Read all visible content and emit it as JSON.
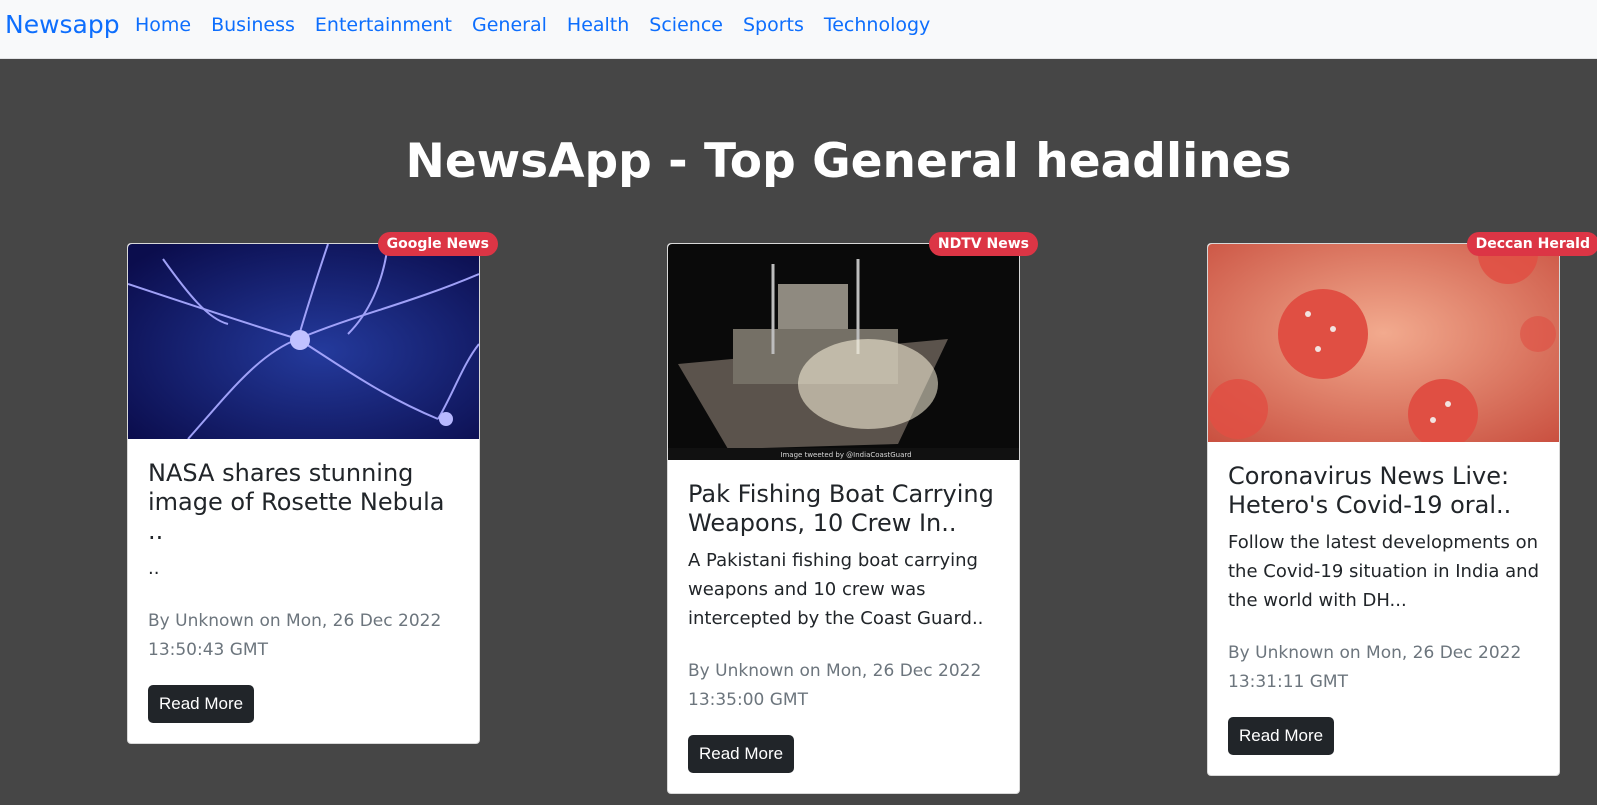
{
  "navbar": {
    "brand": "Newsapp",
    "links": [
      "Home",
      "Business",
      "Entertainment",
      "General",
      "Health",
      "Science",
      "Sports",
      "Technology"
    ]
  },
  "page": {
    "title": "NewsApp - Top General headlines"
  },
  "articles": [
    {
      "source": "Google News",
      "title": "NASA shares stunning image of Rosette Nebula ..",
      "description": "..",
      "meta": "By Unknown on Mon, 26 Dec 2022 13:50:43 GMT",
      "button": "Read More",
      "image_theme": "neurons"
    },
    {
      "source": "NDTV News",
      "title": "Pak Fishing Boat Carrying Weapons, 10 Crew In..",
      "description": "A Pakistani fishing boat carrying weapons and 10 crew was intercepted by the Coast Guard..",
      "meta": "By Unknown on Mon, 26 Dec 2022 13:35:00 GMT",
      "button": "Read More",
      "image_caption": "Image tweeted by @IndiaCoastGuard",
      "image_theme": "boat"
    },
    {
      "source": "Deccan Herald",
      "title": "Coronavirus News Live: Hetero's Covid-19 oral..",
      "description": "Follow the latest developments on the Covid-19 situation in India and the world with DH...",
      "meta": "By Unknown on Mon, 26 Dec 2022 13:31:11 GMT",
      "button": "Read More",
      "image_theme": "virus"
    }
  ]
}
